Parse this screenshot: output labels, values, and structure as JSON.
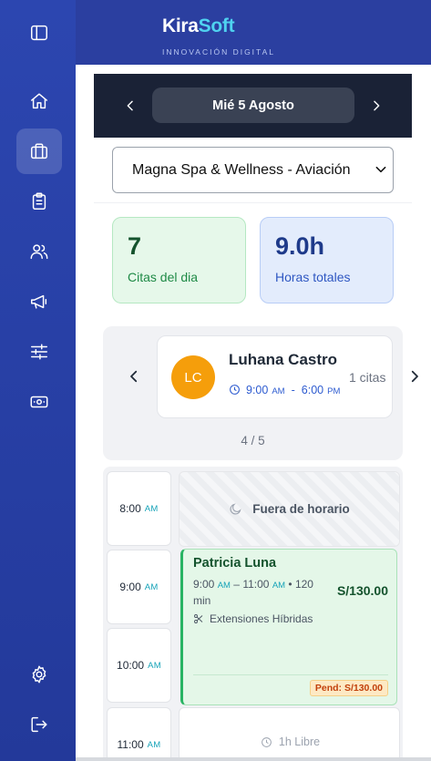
{
  "brand": {
    "name_part1": "Kira",
    "name_part2": "Soft",
    "tagline": "INNOVACIÓN DIGITAL",
    "colors": {
      "sidebar": "#2b3fa0",
      "accent": "#4fd2f0"
    }
  },
  "sidebar": {
    "items": [
      {
        "name": "sidebar-toggle",
        "icon": "panel-left-icon",
        "active": false
      },
      {
        "name": "home",
        "icon": "home-icon",
        "active": false
      },
      {
        "name": "briefcase",
        "icon": "briefcase-icon",
        "active": true
      },
      {
        "name": "clipboard",
        "icon": "clipboard-icon",
        "active": false
      },
      {
        "name": "users",
        "icon": "users-icon",
        "active": false
      },
      {
        "name": "megaphone",
        "icon": "megaphone-icon",
        "active": false
      },
      {
        "name": "sliders",
        "icon": "sliders-icon",
        "active": false
      },
      {
        "name": "payments",
        "icon": "banknote-icon",
        "active": false
      },
      {
        "name": "settings",
        "icon": "gear-icon",
        "active": false
      },
      {
        "name": "logout",
        "icon": "logout-icon",
        "active": false
      }
    ]
  },
  "date_nav": {
    "date_label": "Mié 5 Agosto",
    "prev_icon": "chevron-left-icon",
    "next_icon": "chevron-right-icon"
  },
  "location_select": {
    "value": "Magna Spa & Wellness - Aviación"
  },
  "stats": {
    "appointments": {
      "value": "7",
      "label": "Citas del dia",
      "color": "#e6f8ea"
    },
    "hours": {
      "value": "9.0h",
      "label": "Horas totales",
      "color": "#e3ecfc"
    }
  },
  "staff": {
    "initials": "LC",
    "name": "Luhana Castro",
    "start_time": "9:00",
    "start_ampm": "AM",
    "end_time": "6:00",
    "end_ampm": "PM",
    "dash": "-",
    "count": "1 citas",
    "pager": "4 / 5",
    "avatar_color": "#f59e0b"
  },
  "schedule": {
    "slots": [
      {
        "hour": "8:00",
        "ampm": "AM"
      },
      {
        "hour": "9:00",
        "ampm": "AM"
      },
      {
        "hour": "10:00",
        "ampm": "AM"
      },
      {
        "hour": "11:00",
        "ampm": "AM"
      }
    ],
    "off_hours_label": "Fuera de horario",
    "appointment": {
      "client": "Patricia Luna",
      "start": "9:00",
      "start_ampm": "AM",
      "range_sep": "–",
      "end": "11:00",
      "end_ampm": "AM",
      "bullet": "•",
      "duration": "120 min",
      "price": "S/130.00",
      "service": "Extensiones Híbridas",
      "pending": "Pend: S/130.00",
      "status_color": "#28b463"
    },
    "free_label": "1h Libre"
  }
}
